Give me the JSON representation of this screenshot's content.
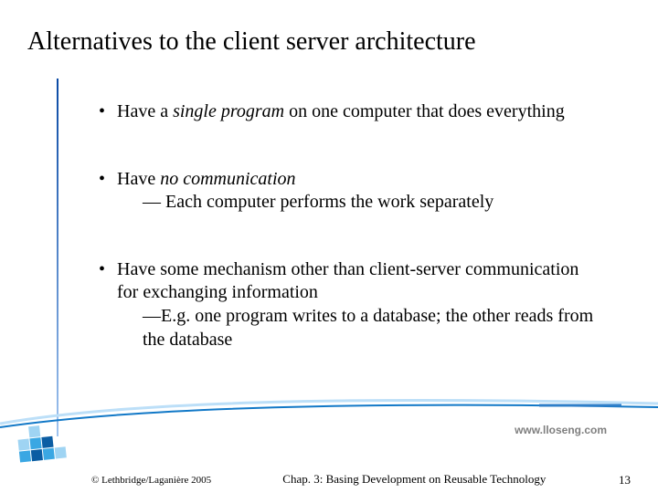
{
  "title": "Alternatives to the client server architecture",
  "bullets": [
    {
      "prefix": "Have a ",
      "em": "single program",
      "suffix": " on one computer that does everything",
      "sublines": []
    },
    {
      "prefix": "Have ",
      "em": "no communication",
      "suffix": "",
      "sublines": [
        "— Each computer performs the work separately"
      ]
    },
    {
      "prefix": "",
      "em": "",
      "suffix": "Have some mechanism other than client-server communication for exchanging information",
      "sublines": [
        "—E.g. one program writes to a database; the other reads from the database"
      ]
    }
  ],
  "website": "www.lloseng.com",
  "footer": {
    "copyright": "© Lethbridge/Laganière 2005",
    "chapter": "Chap. 3: Basing Development on Reusable Technology",
    "page": "13"
  },
  "decor": {
    "accent_primary": "#0b5da3",
    "accent_light": "#9fd4f3"
  }
}
